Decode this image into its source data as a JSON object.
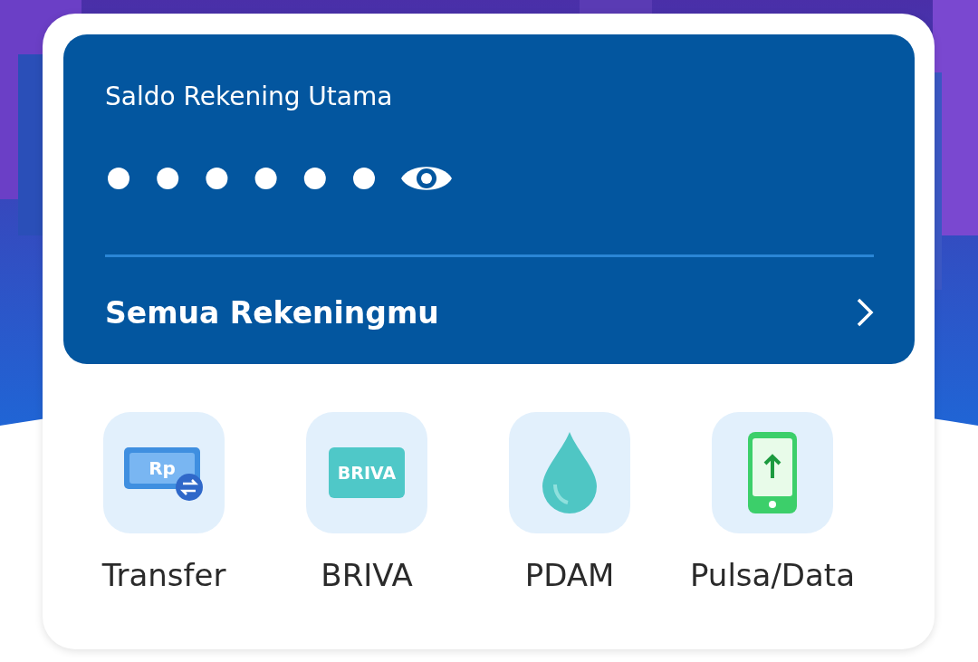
{
  "balance_card": {
    "title": "Saldo Rekening Utama",
    "balance_hidden": true,
    "accounts_link": "Semua Rekeningmu"
  },
  "menu": [
    {
      "kind": "transfer",
      "icon_text": "Rp",
      "label": "Transfer"
    },
    {
      "kind": "briva",
      "icon_text": "BRIVA",
      "label": "BRIVA"
    },
    {
      "kind": "water",
      "label": "PDAM"
    },
    {
      "kind": "phone",
      "label": "Pulsa/Data"
    }
  ]
}
